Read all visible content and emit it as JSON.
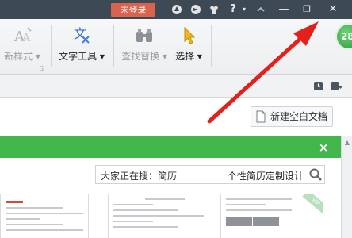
{
  "titlebar": {
    "login_label": "未登录",
    "help_label": "?",
    "icons": [
      "skin-icon",
      "share-icon",
      "shirt-icon",
      "help-icon",
      "collapse-icon"
    ],
    "window_controls": {
      "minimize": "—",
      "restore": "❐",
      "close": "✕"
    }
  },
  "ribbon": {
    "groups": [
      {
        "name": "new-style",
        "label": "新样式",
        "has_dropdown": true,
        "disabled": true
      },
      {
        "name": "text-tools",
        "label": "文字工具",
        "has_dropdown": true,
        "disabled": false
      },
      {
        "name": "find-replace",
        "label": "查找替换",
        "has_dropdown": true,
        "disabled": true
      },
      {
        "name": "select",
        "label": "选择",
        "has_dropdown": true,
        "disabled": false
      }
    ],
    "badge_text": "28"
  },
  "content": {
    "new_doc_label": "新建空白文档",
    "green_close": "×",
    "search": {
      "prefix": "大家正在搜：",
      "hot_term": "简历",
      "query": "个性简历定制设计"
    },
    "thumb_badge": "VIP"
  },
  "colors": {
    "titlebar": "#3d4a56",
    "login_badge": "#d9634c",
    "green_bar": "#41b74b",
    "arrow": "#e3201b"
  }
}
